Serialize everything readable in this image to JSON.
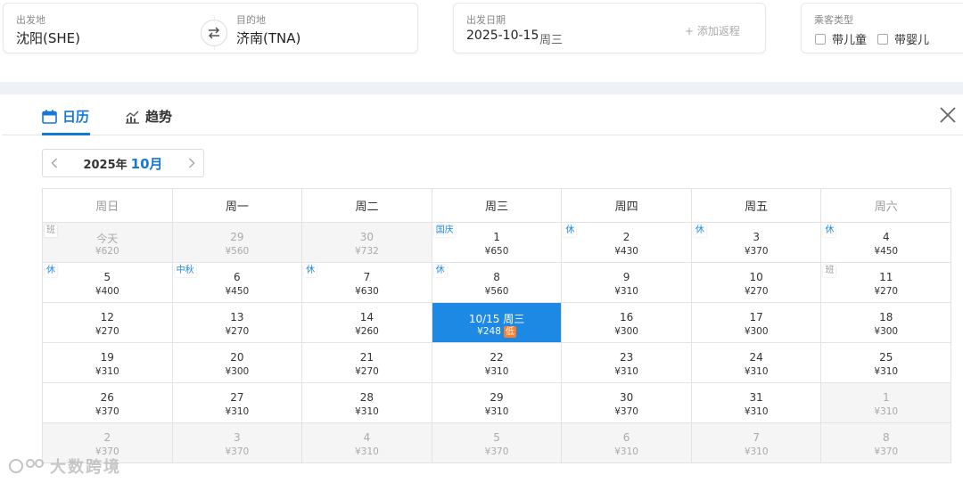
{
  "search": {
    "from": {
      "label": "出发地",
      "value": "沈阳(SHE)"
    },
    "to": {
      "label": "目的地",
      "value": "济南(TNA)"
    },
    "depart": {
      "label": "出发日期",
      "value": "2025-10-15",
      "weekday": "周三",
      "add_return": "+ 添加返程"
    },
    "passenger": {
      "label": "乘客类型",
      "child": "带儿童",
      "infant": "带婴儿"
    }
  },
  "tabs": [
    {
      "label": "日历",
      "icon": "calendar-icon",
      "active": true
    },
    {
      "label": "趋势",
      "icon": "trend-chart-icon",
      "active": false
    }
  ],
  "month_nav": {
    "year": "2025年",
    "month": "10月"
  },
  "weekdays": [
    "周日",
    "周一",
    "周二",
    "周三",
    "周四",
    "周五",
    "周六"
  ],
  "weeks": [
    [
      {
        "day": "今天",
        "price": "¥620",
        "tag": "班",
        "dim": true
      },
      {
        "day": "29",
        "price": "¥560",
        "dim": true
      },
      {
        "day": "30",
        "price": "¥732",
        "dim": true
      },
      {
        "day": "1",
        "price": "¥650",
        "tag": "国庆"
      },
      {
        "day": "2",
        "price": "¥430",
        "tag": "休"
      },
      {
        "day": "3",
        "price": "¥370",
        "tag": "休"
      },
      {
        "day": "4",
        "price": "¥450",
        "tag": "休"
      }
    ],
    [
      {
        "day": "5",
        "price": "¥400",
        "tag": "休"
      },
      {
        "day": "6",
        "price": "¥450",
        "tag": "中秋"
      },
      {
        "day": "7",
        "price": "¥630",
        "tag": "休"
      },
      {
        "day": "8",
        "price": "¥560",
        "tag": "休"
      },
      {
        "day": "9",
        "price": "¥310"
      },
      {
        "day": "10",
        "price": "¥270"
      },
      {
        "day": "11",
        "price": "¥270",
        "tag": "班"
      }
    ],
    [
      {
        "day": "12",
        "price": "¥270"
      },
      {
        "day": "13",
        "price": "¥270"
      },
      {
        "day": "14",
        "price": "¥260"
      },
      {
        "day": "10/15 周三",
        "price": "¥248",
        "selected": true,
        "low": "低"
      },
      {
        "day": "16",
        "price": "¥300"
      },
      {
        "day": "17",
        "price": "¥300"
      },
      {
        "day": "18",
        "price": "¥300"
      }
    ],
    [
      {
        "day": "19",
        "price": "¥310"
      },
      {
        "day": "20",
        "price": "¥300"
      },
      {
        "day": "21",
        "price": "¥270"
      },
      {
        "day": "22",
        "price": "¥310"
      },
      {
        "day": "23",
        "price": "¥310"
      },
      {
        "day": "24",
        "price": "¥310"
      },
      {
        "day": "25",
        "price": "¥310"
      }
    ],
    [
      {
        "day": "26",
        "price": "¥370"
      },
      {
        "day": "27",
        "price": "¥310"
      },
      {
        "day": "28",
        "price": "¥310"
      },
      {
        "day": "29",
        "price": "¥310"
      },
      {
        "day": "30",
        "price": "¥370"
      },
      {
        "day": "31",
        "price": "¥310"
      },
      {
        "day": "1",
        "price": "¥310",
        "dim": true
      }
    ],
    [
      {
        "day": "2",
        "price": "¥370",
        "dim": true
      },
      {
        "day": "3",
        "price": "¥370",
        "dim": true
      },
      {
        "day": "4",
        "price": "¥310",
        "dim": true
      },
      {
        "day": "5",
        "price": "¥370",
        "dim": true
      },
      {
        "day": "6",
        "price": "¥310",
        "dim": true
      },
      {
        "day": "7",
        "price": "¥310",
        "dim": true
      },
      {
        "day": "8",
        "price": "¥370",
        "dim": true
      }
    ]
  ],
  "watermark": "大数跨境",
  "colors": {
    "accent": "#1677d8",
    "selected_bg": "#1e88e5",
    "low_badge": "#ff7d2a"
  }
}
